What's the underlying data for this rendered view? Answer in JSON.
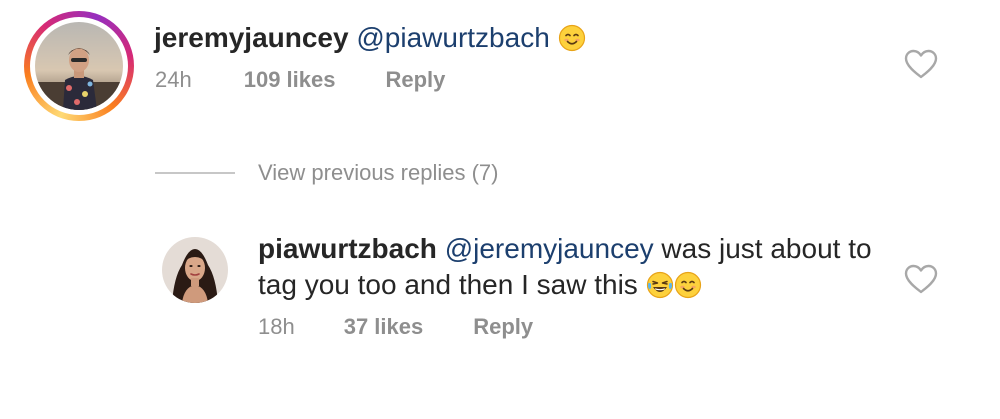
{
  "comments": [
    {
      "username": "jeremyjauncey",
      "mention": "@piawurtzbach",
      "text_after": "",
      "emojis": [
        "smiling-face-emoji"
      ],
      "time": "24h",
      "likes": "109 likes",
      "reply": "Reply",
      "has_story_ring": true
    },
    {
      "username": "piawurtzbach",
      "mention": "@jeremyjauncey",
      "text_after": " was just about to tag you too and then I saw this ",
      "emojis": [
        "tears-of-joy-emoji",
        "smiling-face-emoji"
      ],
      "time": "18h",
      "likes": "37 likes",
      "reply": "Reply",
      "has_story_ring": false
    }
  ],
  "view_previous": {
    "label": "View previous replies (7)"
  },
  "icons": {
    "like": "heart-outline-icon"
  },
  "colors": {
    "text": "#262626",
    "secondary": "#8e8e8e",
    "mention": "#1c3f6e",
    "divider": "#c7c7c7"
  }
}
